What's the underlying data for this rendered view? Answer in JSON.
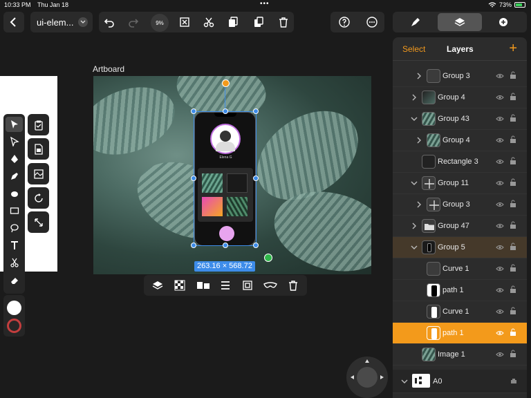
{
  "status_bar": {
    "time": "10:33 PM",
    "date": "Thu Jan 18",
    "battery": "73%"
  },
  "toolbar": {
    "document_title": "ui-elem...",
    "zoom": "9%"
  },
  "canvas": {
    "artboard_label": "Artboard",
    "selection_dims": "263.16 × 568.72"
  },
  "phone": {
    "profile_name": "Elena G"
  },
  "layers_panel": {
    "select_label": "Select",
    "title": "Layers",
    "add_label": "+",
    "items": [
      {
        "name": "Group 3"
      },
      {
        "name": "Group 4"
      },
      {
        "name": "Group 43"
      },
      {
        "name": "Group 4"
      },
      {
        "name": "Rectangle 3"
      },
      {
        "name": "Group 11"
      },
      {
        "name": "Group 3"
      },
      {
        "name": "Group 47"
      },
      {
        "name": "Group 5"
      },
      {
        "name": "Curve 1"
      },
      {
        "name": "path 1"
      },
      {
        "name": "Curve 1"
      },
      {
        "name": "path 1"
      },
      {
        "name": "Image 1"
      },
      {
        "name": "A0"
      }
    ]
  },
  "colors": {
    "accent": "#f39a1b",
    "selection": "#3d8ce9",
    "stroke_color": "#ffffff",
    "fill_color": "#c33e3e"
  }
}
